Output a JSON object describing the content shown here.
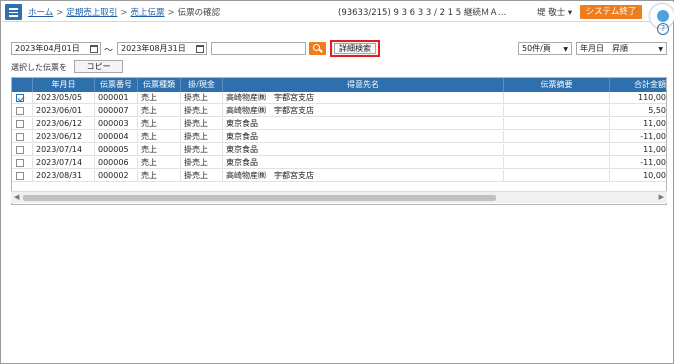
{
  "header": {
    "breadcrumbs": [
      "ホーム",
      "定期売上取引",
      "売上伝票"
    ],
    "current_page": "伝票の確認",
    "user_info": "(93633/215) 9 3 6 3 3 / 2 1 5 継続ＭＡ…",
    "user_name": "堤 敬士 ▾",
    "exit_label": "システム終了",
    "help_label": "?"
  },
  "search": {
    "date_from": "2023年04月01日",
    "date_sep": "〜",
    "date_to": "2023年08月31日",
    "keyword": "",
    "detail_label": "詳細検索",
    "page_size": "50件/頁",
    "sort_order": "年月日　昇順"
  },
  "selection": {
    "label": "選択した伝票を",
    "copy_label": "コピー"
  },
  "table": {
    "columns": [
      "",
      "年月日",
      "伝票番号",
      "伝票種類",
      "掛/現金",
      "得意先名",
      "伝票摘要",
      "合計金額"
    ],
    "rows": [
      {
        "checked": true,
        "date": "2023/05/05",
        "no": "000001",
        "type": "売上",
        "pay": "掛売上",
        "customer": "高崎物産㈱　宇都宮支店",
        "memo": "",
        "total": "110,00"
      },
      {
        "checked": false,
        "date": "2023/06/01",
        "no": "000007",
        "type": "売上",
        "pay": "掛売上",
        "customer": "高崎物産㈱　宇都宮支店",
        "memo": "",
        "total": "5,50"
      },
      {
        "checked": false,
        "date": "2023/06/12",
        "no": "000003",
        "type": "売上",
        "pay": "掛売上",
        "customer": "東京食品",
        "memo": "",
        "total": "11,00"
      },
      {
        "checked": false,
        "date": "2023/06/12",
        "no": "000004",
        "type": "売上",
        "pay": "掛売上",
        "customer": "東京食品",
        "memo": "",
        "total": "-11,00"
      },
      {
        "checked": false,
        "date": "2023/07/14",
        "no": "000005",
        "type": "売上",
        "pay": "掛売上",
        "customer": "東京食品",
        "memo": "",
        "total": "11,00"
      },
      {
        "checked": false,
        "date": "2023/07/14",
        "no": "000006",
        "type": "売上",
        "pay": "掛売上",
        "customer": "東京食品",
        "memo": "",
        "total": "-11,00"
      },
      {
        "checked": false,
        "date": "2023/08/31",
        "no": "000002",
        "type": "売上",
        "pay": "掛売上",
        "customer": "高崎物産㈱　宇都宮支店",
        "memo": "",
        "total": "10,00"
      }
    ]
  },
  "colors": {
    "header_blue": "#2e6fae",
    "accent_orange": "#ee7d1e",
    "highlight_red": "#e02020"
  }
}
